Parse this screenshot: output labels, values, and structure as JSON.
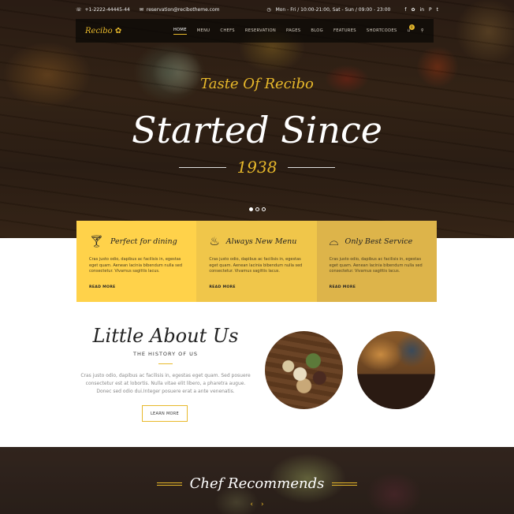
{
  "topbar": {
    "phone": "+1-2222-44445-44",
    "email": "reservation@recibotheme.com",
    "hours": "Mon - Fri / 10:00-21:00, Sat - Sun / 09:00 - 23:00",
    "social": [
      "f",
      "✿",
      "in",
      "P",
      "t"
    ]
  },
  "nav": {
    "logo": "Recibo",
    "items": [
      "HOME",
      "MENU",
      "CHEFS",
      "RESERVATION",
      "PAGES",
      "BLOG",
      "FEATURES",
      "SHORTCODES"
    ],
    "cart_count": "0"
  },
  "hero": {
    "tagline": "Taste Of Recibo",
    "title": "Started Since",
    "year": "1938"
  },
  "features": [
    {
      "icon": "cocktail-icon",
      "title": "Perfect for dining",
      "text": "Cras justo odio, dapibus ac facilisis in, egestas eget quam. Aenean lacinia bibendum nulla sed consectetur. Vivamus sagittis lacus.",
      "more": "READ MORE",
      "bg": "#ffd24a"
    },
    {
      "icon": "dish-icon",
      "title": "Always New Menu",
      "text": "Cras justo odio, dapibus ac facilisis in, egestas eget quam. Aenean lacinia bibendum nulla sed consectetur. Vivamus sagittis lacus.",
      "more": "READ MORE",
      "bg": "#f0c64a"
    },
    {
      "icon": "cloche-icon",
      "title": "Only Best Service",
      "text": "Cras justo odio, dapibus ac facilisis in, egestas eget quam. Aenean lacinia bibendum nulla sed consectetur. Vivamus sagittis lacus.",
      "more": "READ MORE",
      "bg": "#ddb44a"
    }
  ],
  "about": {
    "title": "Little About Us",
    "subtitle": "THE HISTORY OF US",
    "text": "Cras justo odio, dapibus ac facilisis in, egestas eget quam. Sed posuere consectetur est at lobortis. Nulla vitae elit libero, a pharetra augue. Donec sed odio dui.Integer posuere erat a ante venenatis.",
    "button": "LEARN MORE"
  },
  "chef": {
    "title": "Chef Recommends",
    "prev": "‹",
    "next": "›"
  },
  "colors": {
    "accent": "#e8b92b"
  }
}
